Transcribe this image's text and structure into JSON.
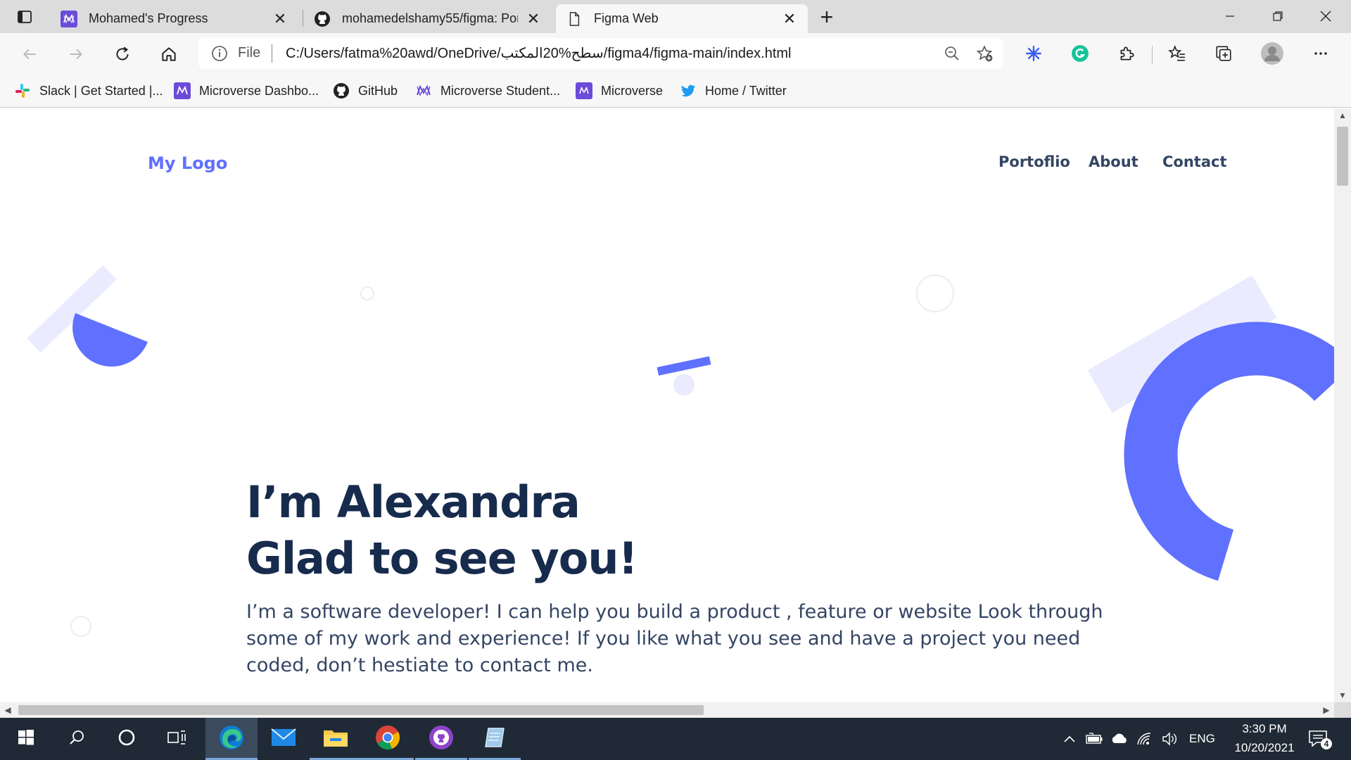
{
  "browser": {
    "tabs": [
      {
        "title": "Mohamed's Progress",
        "icon": "microverse-icon",
        "active": false
      },
      {
        "title": "mohamedelshamy55/figma: Port",
        "icon": "github-icon",
        "active": false
      },
      {
        "title": "Figma Web",
        "icon": "page-icon",
        "active": true
      }
    ],
    "address": {
      "scheme_label": "File",
      "url": "C:/Users/fatma%20awd/OneDrive/سطح%20المكتب/figma4/figma-main/index.html"
    },
    "bookmarks": [
      {
        "label": "Slack | Get Started |...",
        "icon": "slack-icon"
      },
      {
        "label": "Microverse Dashbo...",
        "icon": "microverse-icon"
      },
      {
        "label": "GitHub",
        "icon": "github-icon"
      },
      {
        "label": "Microverse Student...",
        "icon": "microverse-icon"
      },
      {
        "label": "Microverse",
        "icon": "microverse-icon"
      },
      {
        "label": "Home / Twitter",
        "icon": "twitter-icon"
      }
    ]
  },
  "page": {
    "logo": "My Logo",
    "nav": [
      "Portoflio",
      "About",
      "Contact"
    ],
    "hero": {
      "line1": "I’m Alexandra",
      "line2": "Glad to see you!",
      "text": "I’m a software developer! I can help you build a product , feature or website Look through some of my work and experience! If you like what you see and have a project you need coded, don’t hestiate to contact me."
    },
    "colors": {
      "accent": "#6070ff",
      "heading": "#172b4d",
      "body": "#344563",
      "deco_light": "#ebebff"
    }
  },
  "taskbar": {
    "apps": [
      "start-icon",
      "search-icon",
      "cortana-icon",
      "task-view-icon",
      "edge-icon",
      "mail-icon",
      "file-explorer-icon",
      "chrome-icon",
      "github-desktop-icon",
      "notepad-icon"
    ],
    "language": "ENG",
    "time": "3:30 PM",
    "date": "10/20/2021",
    "notification_count": "4"
  }
}
